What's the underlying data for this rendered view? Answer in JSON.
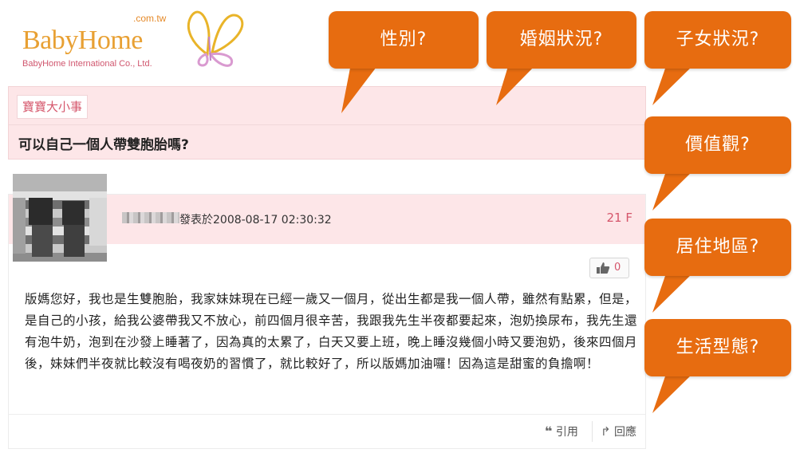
{
  "logo": {
    "domain_suffix": ".com.tw",
    "brand": "BabyHome",
    "company": "BabyHome International Co., Ltd."
  },
  "board": {
    "name": "寶寶大小事"
  },
  "thread": {
    "title": "可以自己一個人帶雙胞胎嗎?"
  },
  "post": {
    "meta": "發表於2008-08-17 02:30:32",
    "floor": "21 F",
    "like_count": "0",
    "body": "版媽您好，我也是生雙胞胎，我家妹妹現在已經一歲又一個月，從出生都是我一個人帶，雖然有點累，但是，是自己的小孩，給我公婆帶我又不放心，前四個月很辛苦，我跟我先生半夜都要起來，泡奶換尿布，我先生還有泡牛奶，泡到在沙發上睡著了，因為真的太累了，白天又要上班，晚上睡沒幾個小時又要泡奶，後來四個月後，妹妹們半夜就比較沒有喝夜奶的習慣了，就比較好了，所以版媽加油囉！因為這是甜蜜的負擔啊！",
    "quote_label": "引用",
    "reply_label": "回應"
  },
  "callouts": [
    {
      "label": "性別?"
    },
    {
      "label": "婚姻狀況?"
    },
    {
      "label": "子女狀況?"
    },
    {
      "label": "價值觀?"
    },
    {
      "label": "居住地區?"
    },
    {
      "label": "生活型態?"
    }
  ],
  "colors": {
    "accent_orange": "#e76c10",
    "pink_panel": "#fde6e8",
    "pink_text": "#d5566b"
  },
  "icons": [
    "butterfly-logo-icon",
    "thumbs-up-icon",
    "quote-icon",
    "reply-arrow-icon"
  ]
}
